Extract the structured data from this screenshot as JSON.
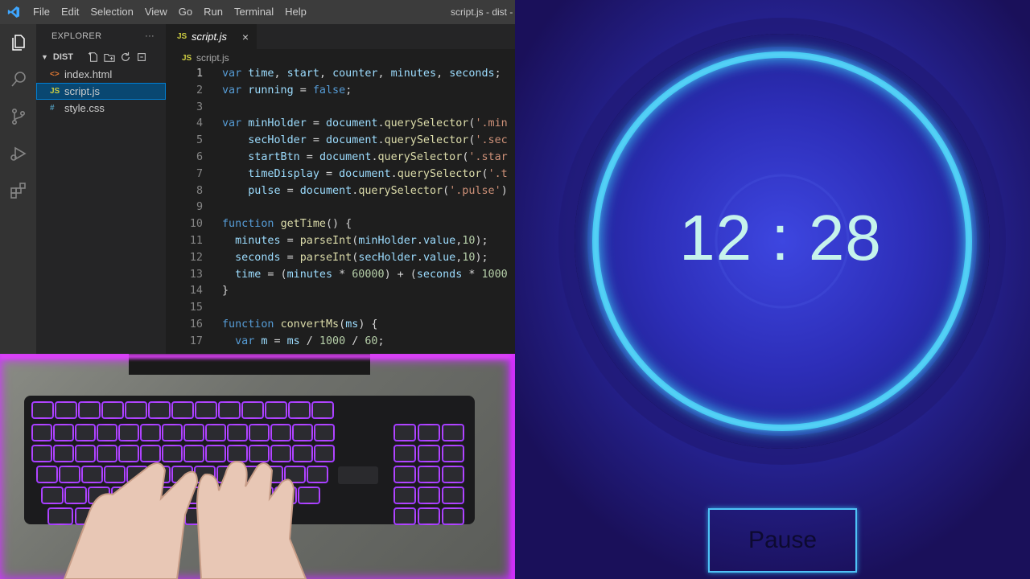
{
  "vscode": {
    "window_title": "script.js - dist - V",
    "menu": [
      "File",
      "Edit",
      "Selection",
      "View",
      "Go",
      "Run",
      "Terminal",
      "Help"
    ],
    "explorer": {
      "title": "EXPLORER",
      "more": "···",
      "folder": "DIST",
      "files": [
        {
          "name": "index.html",
          "icon": "html-icon",
          "icon_text": "<>",
          "icon_color": "#e37933"
        },
        {
          "name": "script.js",
          "icon": "js-icon",
          "icon_text": "JS",
          "icon_color": "#cbcb41",
          "active": true
        },
        {
          "name": "style.css",
          "icon": "css-icon",
          "icon_text": "#",
          "icon_color": "#519aba"
        }
      ]
    },
    "tab": {
      "label": "script.js",
      "close": "×"
    },
    "breadcrumb": {
      "icon_text": "JS",
      "file": "script.js"
    },
    "code_lines": [
      {
        "n": "1"
      },
      {
        "n": "2"
      },
      {
        "n": "3"
      },
      {
        "n": "4"
      },
      {
        "n": "5"
      },
      {
        "n": "6"
      },
      {
        "n": "7"
      },
      {
        "n": "8"
      },
      {
        "n": "9"
      },
      {
        "n": "10"
      },
      {
        "n": "11"
      },
      {
        "n": "12"
      },
      {
        "n": "13"
      },
      {
        "n": "14"
      },
      {
        "n": "15"
      },
      {
        "n": "16"
      },
      {
        "n": "17"
      }
    ],
    "code_text": [
      "var time, start, counter, minutes, seconds;",
      "var running = false;",
      "",
      "var minHolder = document.querySelector('.min",
      "    secHolder = document.querySelector('.sec",
      "    startBtn = document.querySelector('.star",
      "    timeDisplay = document.querySelector('.t",
      "    pulse = document.querySelector('.pulse')",
      "",
      "function getTime() {",
      "  minutes = parseInt(minHolder.value,10);",
      "  seconds = parseInt(secHolder.value,10);",
      "  time = (minutes * 60000) + (seconds * 1000",
      "}",
      "",
      "function convertMs(ms) {",
      "  var m = ms / 1000 / 60;"
    ]
  },
  "timer": {
    "display": "12 : 28",
    "button": "Pause",
    "colors": {
      "background": "#1c1260",
      "ring": "#39c4f2",
      "digits": "#c6f3ec"
    }
  },
  "webcam": {
    "description_icon": "keyboard-typing-icon"
  }
}
